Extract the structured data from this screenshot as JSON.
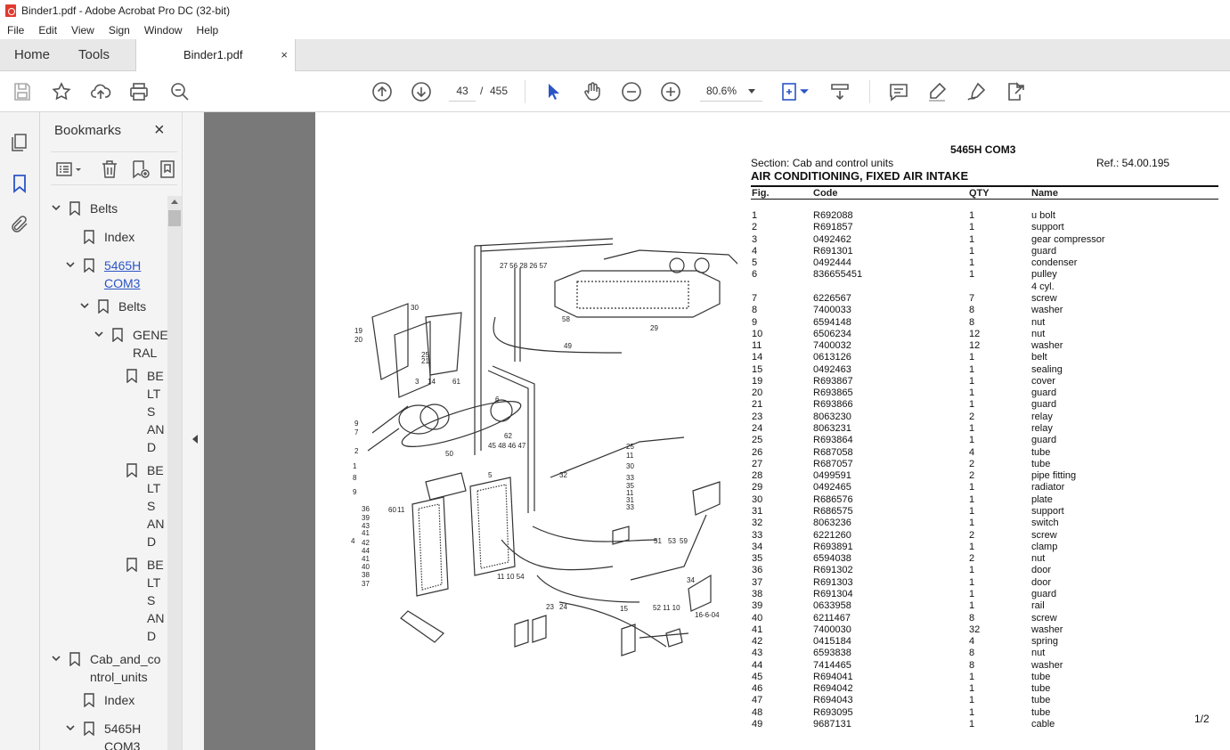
{
  "window": {
    "title": "Binder1.pdf - Adobe Acrobat Pro DC (32-bit)"
  },
  "menu": [
    "File",
    "Edit",
    "View",
    "Sign",
    "Window",
    "Help"
  ],
  "tabs": {
    "home": "Home",
    "tools": "Tools",
    "document": "Binder1.pdf",
    "close": "×"
  },
  "toolbar": {
    "page_current": "43",
    "page_sep": "/",
    "page_total": "455",
    "zoom": "80.6%"
  },
  "bookmarks": {
    "title": "Bookmarks",
    "close": "×",
    "items": [
      {
        "label": "Belts"
      },
      {
        "label": "Index"
      },
      {
        "label": "5465H\nCOM3"
      },
      {
        "label": "Belts"
      },
      {
        "label": "GENE\nRAL"
      },
      {
        "label": "BE\nLT\nS\nAN\nD"
      },
      {
        "label": "BE\nLT\nS\nAN\nD"
      },
      {
        "label": "BE\nLT\nS\nAN\nD"
      },
      {
        "label": "Cab_and_co\nntrol_units"
      },
      {
        "label": "Index"
      },
      {
        "label": "5465H\nCOM3"
      }
    ]
  },
  "document": {
    "model": "5465H COM3",
    "section": "Section: Cab and control units",
    "ref": "Ref.: 54.00.195",
    "heading": "AIR CONDITIONING, FIXED AIR INTAKE",
    "columns": {
      "fig": "Fig.",
      "code": "Code",
      "qty": "QTY",
      "name": "Name"
    },
    "rows": [
      [
        "1",
        "R692088",
        "1",
        "u bolt"
      ],
      [
        "2",
        "R691857",
        "1",
        "support"
      ],
      [
        "3",
        "0492462",
        "1",
        "gear compressor"
      ],
      [
        "4",
        "R691301",
        "1",
        "guard"
      ],
      [
        "5",
        "0492444",
        "1",
        "condenser"
      ],
      [
        "6",
        "836655451",
        "1",
        "pulley"
      ],
      [
        "",
        "",
        "",
        "4 cyl."
      ],
      [
        "7",
        "6226567",
        "7",
        "screw"
      ],
      [
        "8",
        "7400033",
        "8",
        "washer"
      ],
      [
        "9",
        "6594148",
        "8",
        "nut"
      ],
      [
        "10",
        "6506234",
        "12",
        "nut"
      ],
      [
        "11",
        "7400032",
        "12",
        "washer"
      ],
      [
        "14",
        "0613126",
        "1",
        "belt"
      ],
      [
        "15",
        "0492463",
        "1",
        "sealing"
      ],
      [
        "19",
        "R693867",
        "1",
        "cover"
      ],
      [
        "20",
        "R693865",
        "1",
        "guard"
      ],
      [
        "21",
        "R693866",
        "1",
        "guard"
      ],
      [
        "23",
        "8063230",
        "2",
        "relay"
      ],
      [
        "24",
        "8063231",
        "1",
        "relay"
      ],
      [
        "25",
        "R693864",
        "1",
        "guard"
      ],
      [
        "26",
        "R687058",
        "4",
        "tube"
      ],
      [
        "27",
        "R687057",
        "2",
        "tube"
      ],
      [
        "28",
        "0499591",
        "2",
        "pipe fitting"
      ],
      [
        "29",
        "0492465",
        "1",
        "radiator"
      ],
      [
        "30",
        "R686576",
        "1",
        "plate"
      ],
      [
        "31",
        "R686575",
        "1",
        "support"
      ],
      [
        "32",
        "8063236",
        "1",
        "switch"
      ],
      [
        "33",
        "6221260",
        "2",
        "screw"
      ],
      [
        "34",
        "R693891",
        "1",
        "clamp"
      ],
      [
        "35",
        "6594038",
        "2",
        "nut"
      ],
      [
        "36",
        "R691302",
        "1",
        "door"
      ],
      [
        "37",
        "R691303",
        "1",
        "door"
      ],
      [
        "38",
        "R691304",
        "1",
        "guard"
      ],
      [
        "39",
        "0633958",
        "1",
        "rail"
      ],
      [
        "40",
        "6211467",
        "8",
        "screw"
      ],
      [
        "41",
        "7400030",
        "32",
        "washer"
      ],
      [
        "42",
        "0415184",
        "4",
        "spring"
      ],
      [
        "43",
        "6593838",
        "8",
        "nut"
      ],
      [
        "44",
        "7414465",
        "8",
        "washer"
      ],
      [
        "45",
        "R694041",
        "1",
        "tube"
      ],
      [
        "46",
        "R694042",
        "1",
        "tube"
      ],
      [
        "47",
        "R694043",
        "1",
        "tube"
      ],
      [
        "48",
        "R693095",
        "1",
        "tube"
      ],
      [
        "49",
        "9687131",
        "1",
        "cable"
      ]
    ],
    "page_footer": "1/2",
    "diagram_code": "16-6-04",
    "callouts": [
      "27",
      "56",
      "28",
      "26",
      "57",
      "29",
      "58",
      "49",
      "19",
      "20",
      "30",
      "25",
      "21",
      "3",
      "14",
      "61",
      "6",
      "9",
      "7",
      "2",
      "1",
      "8",
      "9",
      "50",
      "45",
      "48",
      "46",
      "47",
      "62",
      "5",
      "25",
      "11",
      "30",
      "33",
      "35",
      "11",
      "31",
      "33",
      "32",
      "36",
      "39",
      "43",
      "41",
      "60",
      "11",
      "4",
      "42",
      "44",
      "41",
      "40",
      "38",
      "37",
      "11",
      "10",
      "54",
      "23",
      "24",
      "15",
      "51",
      "53",
      "59",
      "34",
      "52",
      "11",
      "10"
    ]
  },
  "colors": {
    "accent": "#2b55c7",
    "doc_bg": "#797979",
    "pdf_red": "#e03a2f"
  },
  "icons": [
    "save-icon",
    "bookmark-star-icon",
    "upload-icon",
    "print-icon",
    "zoom-search-icon",
    "page-up-icon",
    "page-down-icon",
    "select-arrow-icon",
    "hand-icon",
    "zoom-out-icon",
    "zoom-in-icon",
    "fit-page-icon",
    "scroll-mode-icon",
    "comment-icon",
    "highlight-icon",
    "sign-icon",
    "export-icon",
    "thumbnails-icon",
    "bookmarks-icon",
    "attachments-icon"
  ]
}
